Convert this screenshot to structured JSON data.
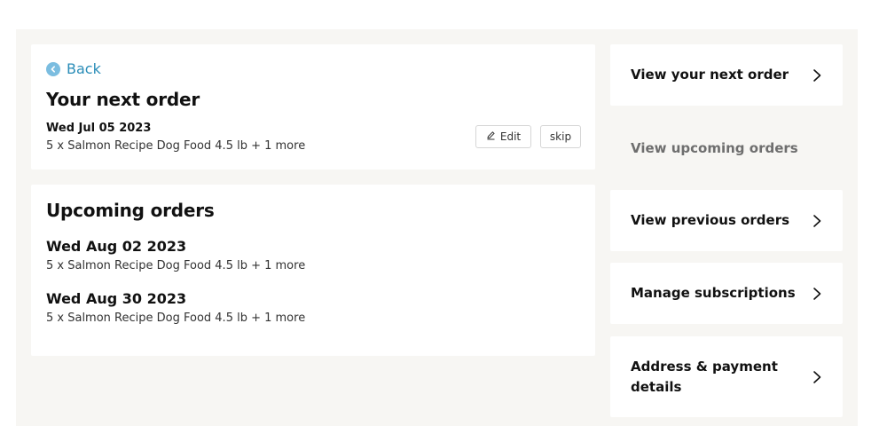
{
  "next_order": {
    "back_label": "Back",
    "title": "Your next order",
    "date": "Wed Jul 05 2023",
    "summary": "5 x Salmon Recipe Dog Food 4.5 lb + 1 more",
    "edit_label": "Edit",
    "skip_label": "skip"
  },
  "upcoming": {
    "title": "Upcoming orders",
    "orders": [
      {
        "date": "Wed Aug 02 2023",
        "summary": "5 x Salmon Recipe Dog Food 4.5 lb + 1 more"
      },
      {
        "date": "Wed Aug 30 2023",
        "summary": "5 x Salmon Recipe Dog Food 4.5 lb + 1 more"
      }
    ]
  },
  "nav": {
    "items": [
      {
        "label": "View your next order",
        "icon": "chevron-right-icon",
        "active": false
      },
      {
        "label": "View upcoming orders",
        "icon": "",
        "active": true
      },
      {
        "label": "View previous orders",
        "icon": "chevron-right-icon",
        "active": false
      },
      {
        "label": "Manage subscriptions",
        "icon": "chevron-right-icon",
        "active": false
      },
      {
        "label": "Address & payment details",
        "icon": "chevron-right-icon",
        "active": false
      }
    ]
  },
  "colors": {
    "link": "#2a8db8",
    "background": "#f7f6f3",
    "card": "#ffffff",
    "muted_text": "#6e6e6e"
  }
}
